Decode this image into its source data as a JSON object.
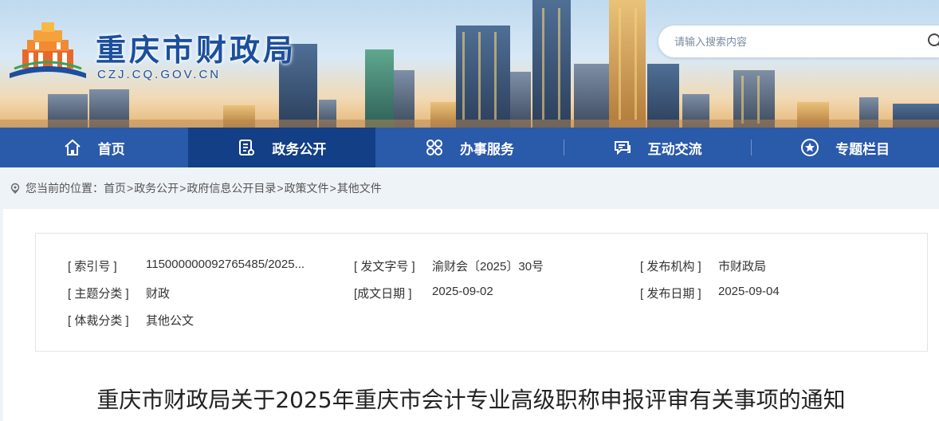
{
  "site": {
    "title": "重庆市财政局",
    "url": "CZJ.CQ.GOV.CN"
  },
  "search": {
    "placeholder": "请输入搜索内容"
  },
  "nav": {
    "items": [
      {
        "label": "首页",
        "icon": "home-icon"
      },
      {
        "label": "政务公开",
        "icon": "document-list-icon",
        "active": true
      },
      {
        "label": "办事服务",
        "icon": "services-grid-icon"
      },
      {
        "label": "互动交流",
        "icon": "chat-bubble-icon"
      },
      {
        "label": "专题栏目",
        "icon": "star-circle-icon"
      }
    ]
  },
  "breadcrumb": {
    "prefix": "您当前的位置：",
    "items": [
      "首页",
      "政务公开",
      "政府信息公开目录",
      "政策文件",
      "其他文件"
    ],
    "separator": ">"
  },
  "meta": {
    "index_label": "[ 索引号 ]",
    "index_value": "115000000092765485/2025...",
    "doc_no_label": "[ 发文字号 ]",
    "doc_no_value": "渝财会〔2025〕30号",
    "issuer_label": "[ 发布机构 ]",
    "issuer_value": "市财政局",
    "topic_label": "[ 主题分类 ]",
    "topic_value": "财政",
    "written_label": "[成文日期 ]",
    "written_value": "2025-09-02",
    "publish_label": "[ 发布日期 ]",
    "publish_value": "2025-09-04",
    "genre_label": "[ 体裁分类 ]",
    "genre_value": "其他公文"
  },
  "article": {
    "title": "重庆市财政局关于2025年重庆市会计专业高级职称申报评审有关事项的通知"
  },
  "colors": {
    "nav_bg": "#2a5aaa",
    "nav_active": "#123f86",
    "brand_blue": "#1c4f9c",
    "page_bg": "#eef3f8"
  }
}
